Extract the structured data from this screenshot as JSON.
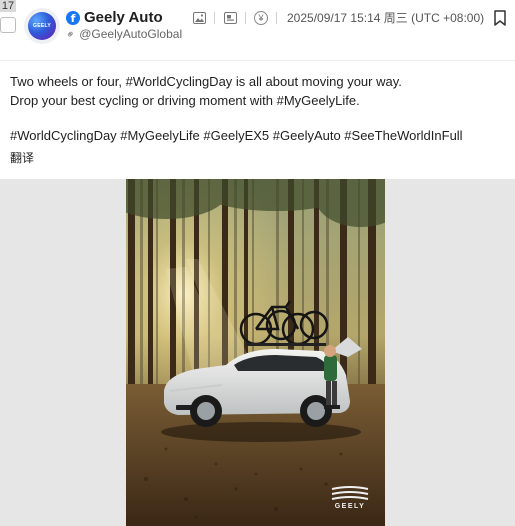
{
  "row_number": "17",
  "author": {
    "avatar_text": "GEELY",
    "name": "Geely Auto",
    "handle": "@GeelyAutoGlobal",
    "platform_icon": "facebook-icon"
  },
  "meta": {
    "icons": [
      "image-icon",
      "gallery-icon",
      "yen-icon"
    ],
    "timestamp": "2025/09/17 15:14 周三 (UTC +08:00)"
  },
  "post": {
    "line1": "Two wheels or four, #WorldCyclingDay is all about moving your way.",
    "line2": "Drop your best cycling or driving moment with #MyGeelyLife.",
    "hashtags": "#WorldCyclingDay #MyGeelyLife #GeelyEX5 #GeelyAuto #SeeTheWorldInFull",
    "translate_label": "翻译"
  },
  "photo": {
    "logo_text": "GEELY"
  },
  "colors": {
    "facebook": "#1877f2",
    "media_bg": "#e6e6e6"
  }
}
